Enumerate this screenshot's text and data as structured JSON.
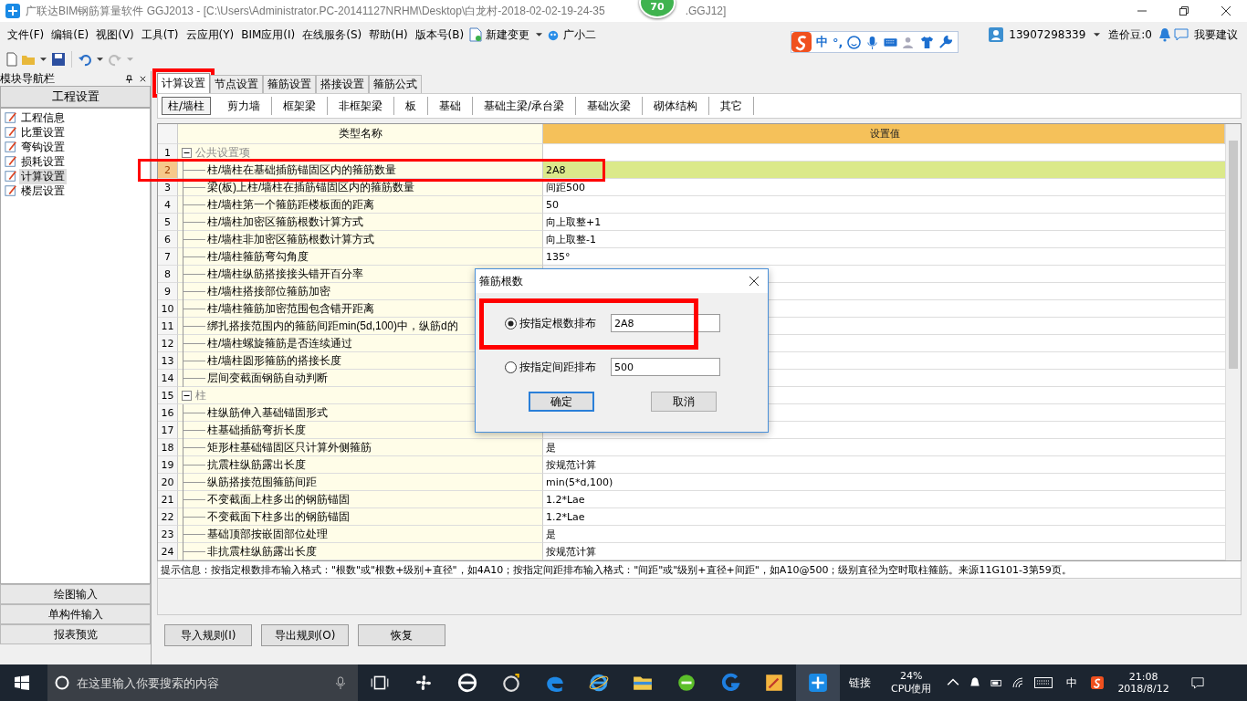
{
  "window": {
    "title": "广联达BIM钢筋算量软件 GGJ2013 - [C:\\Users\\Administrator.PC-20141127NRHM\\Desktop\\白龙村-2018-02-02-19-24-35",
    "title_end": ".GGJ12]"
  },
  "score_badge": "70",
  "menu": [
    "文件(F)",
    "编辑(E)",
    "视图(V)",
    "工具(T)",
    "云应用(Y)",
    "BIM应用(I)",
    "在线服务(S)",
    "帮助(H)",
    "版本号(B)"
  ],
  "commands": [
    {
      "label": "新建变更",
      "kind": "document",
      "dropdown": true
    },
    {
      "label": "广小二",
      "kind": "mascot",
      "dropdown": false
    }
  ],
  "ime_toolbar": {
    "mode": "中",
    "punct": "°,"
  },
  "account": {
    "phone": "13907298339",
    "points": "造价豆:0",
    "feedback": "我要建议"
  },
  "nav": {
    "title": "模块导航栏",
    "section": "工程设置",
    "items": [
      {
        "label": "工程信息",
        "selected": false
      },
      {
        "label": "比重设置",
        "selected": false
      },
      {
        "label": "弯钩设置",
        "selected": false
      },
      {
        "label": "损耗设置",
        "selected": false
      },
      {
        "label": "计算设置",
        "selected": true
      },
      {
        "label": "楼层设置",
        "selected": false
      }
    ],
    "bottom": [
      "绘图输入",
      "单构件输入",
      "报表预览"
    ]
  },
  "tabs": [
    {
      "label": "计算设置",
      "selected": true,
      "highlighted": true
    },
    {
      "label": "节点设置",
      "selected": false,
      "highlighted": false
    },
    {
      "label": "箍筋设置",
      "selected": false,
      "highlighted": false
    },
    {
      "label": "搭接设置",
      "selected": false,
      "highlighted": false
    },
    {
      "label": "箍筋公式",
      "selected": false,
      "highlighted": false
    }
  ],
  "subtabs": [
    {
      "label": "柱/墙柱",
      "selected": true
    },
    {
      "label": "剪力墙",
      "selected": false
    },
    {
      "label": "框架梁",
      "selected": false
    },
    {
      "label": "非框架梁",
      "selected": false
    },
    {
      "label": "板",
      "selected": false
    },
    {
      "label": "基础",
      "selected": false
    },
    {
      "label": "基础主梁/承台梁",
      "selected": false
    },
    {
      "label": "基础次梁",
      "selected": false
    },
    {
      "label": "砌体结构",
      "selected": false
    },
    {
      "label": "其它",
      "selected": false
    }
  ],
  "table": {
    "columns": [
      "类型名称",
      "设置值"
    ],
    "groups": [
      {
        "number": "1",
        "name": "公共设置项",
        "expanded": true,
        "children": [
          {
            "number": "2",
            "name": "柱/墙柱在基础插筋锚固区内的箍筋数量",
            "value": "2A8",
            "selected": true,
            "highlighted": true
          },
          {
            "number": "3",
            "name": "梁(板)上柱/墙柱在插筋锚固区内的箍筋数量",
            "value": "间距500",
            "selected": false,
            "highlighted": false
          },
          {
            "number": "4",
            "name": "柱/墙柱第一个箍筋距楼板面的距离",
            "value": "50",
            "selected": false,
            "highlighted": false
          },
          {
            "number": "5",
            "name": "柱/墙柱加密区箍筋根数计算方式",
            "value": "向上取整+1",
            "selected": false,
            "highlighted": false
          },
          {
            "number": "6",
            "name": "柱/墙柱非加密区箍筋根数计算方式",
            "value": "向上取整-1",
            "selected": false,
            "highlighted": false
          },
          {
            "number": "7",
            "name": "柱/墙柱箍筋弯勾角度",
            "value": "135°",
            "selected": false,
            "highlighted": false
          },
          {
            "number": "8",
            "name": "柱/墙柱纵筋搭接接头错开百分率",
            "selected": false,
            "highlighted": false
          },
          {
            "number": "9",
            "name": "柱/墙柱搭接部位箍筋加密",
            "selected": false,
            "highlighted": false
          },
          {
            "number": "10",
            "name": "柱/墙柱箍筋加密范围包含错开距离",
            "selected": false,
            "highlighted": false
          },
          {
            "number": "11",
            "name": "绑扎搭接范围内的箍筋间距min(5d,100)中，纵筋d的",
            "selected": false,
            "highlighted": false
          },
          {
            "number": "12",
            "name": "柱/墙柱螺旋箍筋是否连续通过",
            "selected": false,
            "highlighted": false
          },
          {
            "number": "13",
            "name": "柱/墙柱圆形箍筋的搭接长度",
            "selected": false,
            "highlighted": false
          },
          {
            "number": "14",
            "name": "层间变截面钢筋自动判断",
            "selected": false,
            "highlighted": false
          }
        ]
      },
      {
        "number": "15",
        "name": "柱",
        "expanded": true,
        "children": [
          {
            "number": "16",
            "name": "柱纵筋伸入基础锚固形式",
            "selected": false,
            "highlighted": false
          },
          {
            "number": "17",
            "name": "柱基础插筋弯折长度",
            "selected": false,
            "highlighted": false
          },
          {
            "number": "18",
            "name": "矩形柱基础锚固区只计算外侧箍筋",
            "value": "是",
            "selected": false,
            "highlighted": false
          },
          {
            "number": "19",
            "name": "抗震柱纵筋露出长度",
            "value": "按规范计算",
            "selected": false,
            "highlighted": false
          },
          {
            "number": "20",
            "name": "纵筋搭接范围箍筋间距",
            "value": "min(5*d,100)",
            "selected": false,
            "highlighted": false
          },
          {
            "number": "21",
            "name": "不变截面上柱多出的钢筋锚固",
            "value": "1.2*Lae",
            "selected": false,
            "highlighted": false
          },
          {
            "number": "22",
            "name": "不变截面下柱多出的钢筋锚固",
            "value": "1.2*Lae",
            "selected": false,
            "highlighted": false
          },
          {
            "number": "23",
            "name": "基础顶部按嵌固部位处理",
            "value": "是",
            "selected": false,
            "highlighted": false
          },
          {
            "number": "24",
            "name": "非抗震柱纵筋露出长度",
            "value": "按规范计算",
            "selected": false,
            "highlighted": false
          }
        ]
      }
    ]
  },
  "hint": "提示信息：按指定根数排布输入格式：\"根数\"或\"根数+级别+直径\"，如4A10；按指定间距排布输入格式：\"间距\"或\"级别+直径+间距\"，如A10@500；级别直径为空时取柱箍筋。来源11G101-3第59页。",
  "buttons": [
    "导入规则(I)",
    "导出规则(O)",
    "恢复"
  ],
  "dialog": {
    "title": "箍筋根数",
    "options": [
      {
        "label": "按指定根数排布",
        "value": "2A8",
        "selected": true,
        "highlighted": true
      },
      {
        "label": "按指定间距排布",
        "value": "500",
        "selected": false,
        "highlighted": false
      }
    ],
    "ok": "确定",
    "cancel": "取消"
  },
  "taskbar": {
    "search_placeholder": "在这里输入你要搜索的内容",
    "link": "链接",
    "cpu": "24%",
    "cpu_label": "CPU使用",
    "ime": "中",
    "time": "21:08",
    "date": "2018/8/12"
  }
}
